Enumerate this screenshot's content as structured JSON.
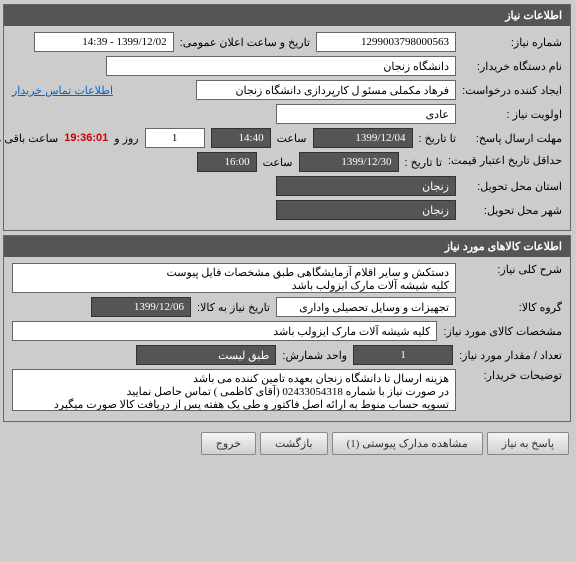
{
  "panel1": {
    "title": "اطلاعات نیاز",
    "need_no_label": "شماره نیاز:",
    "need_no": "1299003798000563",
    "announce_label": "تاریخ و ساعت اعلان عمومی:",
    "announce_value": "1399/12/02 - 14:39",
    "buyer_label": "نام دستگاه خریدار:",
    "buyer_value": "دانشگاه زنجان",
    "requester_label": "ایجاد کننده درخواست:",
    "requester_value": "فرهاد مکملی مسئو ل کارپردازی دانشگاه زنجان",
    "contact_link": "اطلاعات تماس خریدار",
    "priority_label": "اولویت نیاز :",
    "priority_value": "عادی",
    "deadline_label": "مهلت ارسال پاسخ:",
    "to_date_label": "تا تاریخ :",
    "deadline_date": "1399/12/04",
    "time_label": "ساعت",
    "deadline_time": "14:40",
    "days_value": "1",
    "days_label": "روز و",
    "countdown": "19:36:01",
    "remain_label": "ساعت باقی مانده",
    "credit_label": "حداقل تاریخ اعتبار قیمت:",
    "credit_to": "تا تاریخ :",
    "credit_date": "1399/12/30",
    "credit_time": "16:00",
    "province_label": "استان محل تحویل:",
    "province_value": "زنجان",
    "city_label": "شهر محل تحویل:",
    "city_value": "زنجان"
  },
  "panel2": {
    "title": "اطلاعات کالاهای مورد نیاز",
    "desc_label": "شرح کلی نیاز:",
    "desc_value": "دستکش و سایر اقلام آزمایشگاهی طبق مشخصات فایل پیوست\nکلیه شیشه آلات مارک ایزولب باشد",
    "group_label": "گروه کالا:",
    "group_value": "تجهیزات و وسایل تحصیلی واداری",
    "need_date_label": "تاریخ نیاز به کالا:",
    "need_date_value": "1399/12/06",
    "spec_label": "مشخصات کالای مورد نیاز:",
    "spec_value": "کلیه شیشه آلات مارک ایزولب باشد",
    "qty_label": "تعداد / مقدار مورد نیاز:",
    "qty_value": "1",
    "unit_label": "واحد شمارش:",
    "unit_value": "طبق لیست",
    "notes_label": "توضیحات خریدار:",
    "notes_value": "هزینه ارسال تا دانشگاه زنجان بعهده تامین کننده می باشد\nدر صورت نیاز با شماره 02433054318 (آقای کاظمی ) تماس حاصل نمایید\nتسویه حساب منوط به ارائه اصل فاکتور و طی یک هفته پس از دریافت کالا صورت میگیرد"
  },
  "buttons": {
    "reply": "پاسخ به نیاز",
    "attachments": "مشاهده مدارک پیوستی (1)",
    "back": "بازگشت",
    "exit": "خروج"
  }
}
